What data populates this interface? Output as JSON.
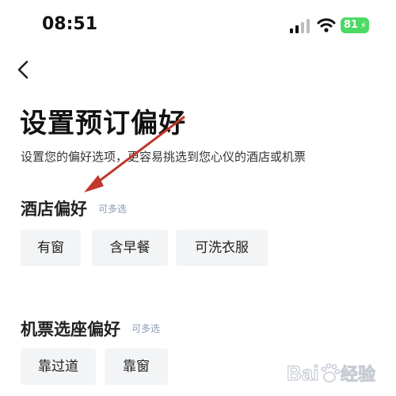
{
  "status_bar": {
    "time": "08:51",
    "battery_level": "81",
    "battery_color": "#4cd964",
    "icons": [
      "signal-icon",
      "wifi-icon",
      "battery-icon"
    ]
  },
  "nav": {
    "back_icon": "chevron-left-icon"
  },
  "header": {
    "title": "设置预订偏好",
    "subtitle": "设置您的偏好选项，更容易挑选到您心仪的酒店或机票"
  },
  "hotel": {
    "title": "酒店偏好",
    "hint": "可多选",
    "options": [
      "有窗",
      "含早餐",
      "可洗衣服"
    ]
  },
  "flight": {
    "title": "机票选座偏好",
    "hint": "可多选",
    "options": [
      "靠过道",
      "靠窗"
    ]
  },
  "annotation": {
    "color": "#c0392b"
  },
  "watermark": {
    "text": "Baidu经验"
  }
}
